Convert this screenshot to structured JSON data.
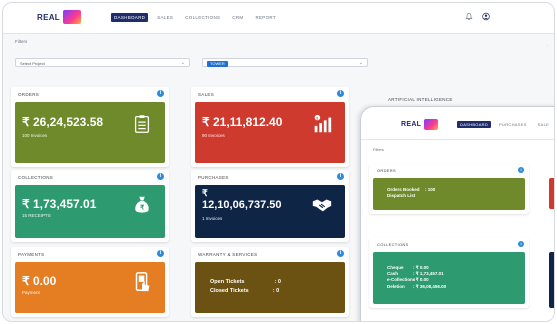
{
  "brand": {
    "logo_text": "REAL"
  },
  "nav": {
    "items": [
      {
        "label": "DASHBOARD",
        "active": true
      },
      {
        "label": "SALES",
        "active": false
      },
      {
        "label": "COLLECTIONS",
        "active": false
      },
      {
        "label": "CRM",
        "active": false
      },
      {
        "label": "REPORT",
        "active": false
      }
    ]
  },
  "filters": {
    "label": "Filters",
    "project": {
      "value": "Select Project"
    },
    "tower": {
      "value": "TOWER"
    }
  },
  "ai_section": {
    "label": "ARTIFICIAL INTELLIGENCE"
  },
  "cards": {
    "orders": {
      "title": "ORDERS",
      "amount": "₹ 26,24,523.58",
      "sub": "100 Invoices",
      "color": "#6e8a2b"
    },
    "sales": {
      "title": "SALES",
      "amount": "₹ 21,11,812.40",
      "sub": "90 Invoices",
      "color": "#cf3a2f"
    },
    "collections": {
      "title": "COLLECTIONS",
      "amount": "₹ 1,73,457.01",
      "sub": "15 RECEIPTS",
      "color": "#2e9a70"
    },
    "purchases": {
      "title": "PURCHASES",
      "currency": "₹",
      "amount": "12,10,06,737.50",
      "sub": "1 Invoices",
      "color": "#0f2545"
    },
    "payments": {
      "title": "PAYMENTS",
      "amount": "₹ 0.00",
      "sub": "Payment",
      "color": "#e57e22"
    },
    "warranty": {
      "title": "WARRANTY & SERVICES",
      "rows": [
        {
          "label": "Open Tickets",
          "value": ": 0"
        },
        {
          "label": "Closed Tickets",
          "value": ": 0"
        }
      ],
      "color": "#6b5212"
    }
  },
  "overlay": {
    "logo_text": "REAL",
    "nav": [
      {
        "label": "DASHBOARD",
        "active": true
      },
      {
        "label": "PURCHASES",
        "active": false
      },
      {
        "label": "SALE",
        "active": false
      }
    ],
    "filters_label": "Filters",
    "orders": {
      "title": "ORDERS",
      "rows": [
        {
          "label": "Orders Booked",
          "value": ": 100"
        },
        {
          "label": "Dispatch List",
          "value": ""
        }
      ]
    },
    "collections": {
      "title": "COLLECTIONS",
      "rows": [
        {
          "label": "Cheque",
          "value": ": ₹ 0.00"
        },
        {
          "label": "Cash",
          "value": ": ₹ 1,73,457.01"
        },
        {
          "label": "e-Collections",
          "value": ": ₹ 0.00"
        },
        {
          "label": "Deletion",
          "value": ": ₹ 36,08,456.00"
        }
      ]
    }
  }
}
